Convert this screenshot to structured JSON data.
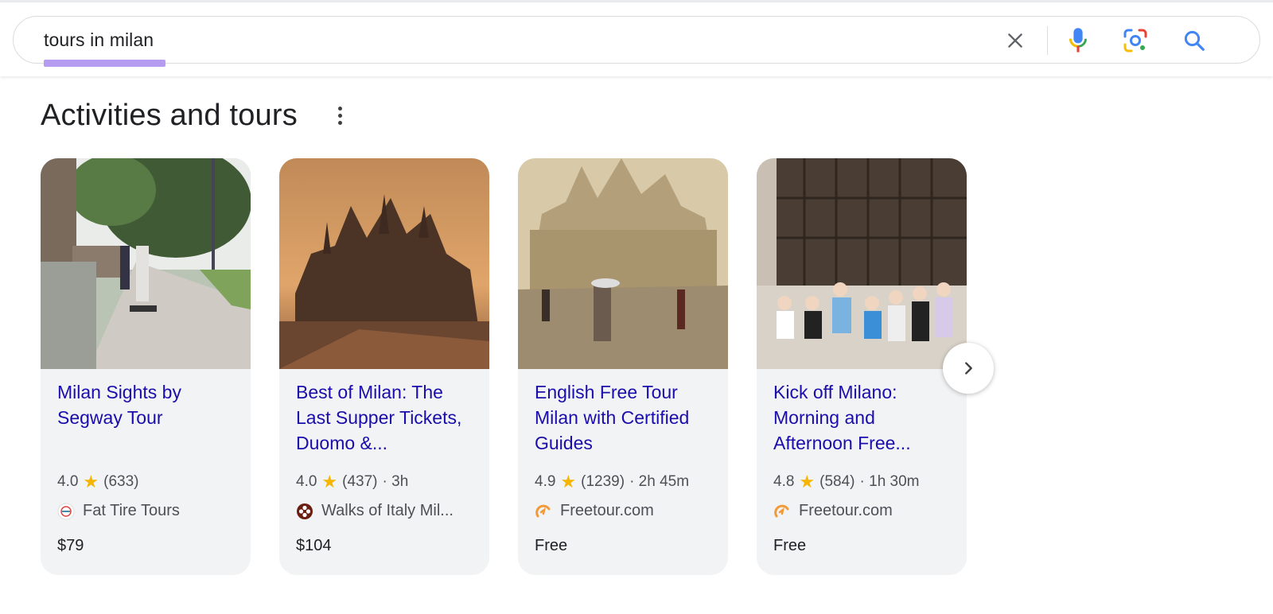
{
  "search": {
    "query": "tours in milan"
  },
  "section": {
    "title": "Activities and tours"
  },
  "cards": [
    {
      "title": "Milan Sights by Segway Tour",
      "rating": "4.0",
      "reviews": "(633)",
      "duration": "",
      "provider": "Fat Tire Tours",
      "price": "$79",
      "image": "segway-tour-photo"
    },
    {
      "title": "Best of Milan: The Last Supper Tickets, Duomo &...",
      "rating": "4.0",
      "reviews": "(437)",
      "duration": "· 3h",
      "provider": "Walks of Italy Mil...",
      "price": "$104",
      "image": "duomo-sunset-photo"
    },
    {
      "title": "English Free Tour Milan with Certified Guides",
      "rating": "4.9",
      "reviews": "(1239)",
      "duration": "· 2h 45m",
      "provider": "Freetour.com",
      "price": "Free",
      "image": "duomo-square-photo"
    },
    {
      "title": "Kick off Milano: Morning and Afternoon Free...",
      "rating": "4.8",
      "reviews": "(584)",
      "duration": "· 1h 30m",
      "provider": "Freetour.com",
      "price": "Free",
      "image": "group-photo"
    }
  ],
  "icons": {
    "clear": "close-icon",
    "voice": "microphone-icon",
    "lens": "camera-lens-icon",
    "search": "search-icon",
    "more": "more-vert-icon",
    "next": "chevron-right-icon",
    "star": "star-icon"
  },
  "colors": {
    "link": "#1a0dab",
    "star": "#f6b500",
    "card_bg": "#f1f3f4",
    "underline": "#b69cf0"
  }
}
